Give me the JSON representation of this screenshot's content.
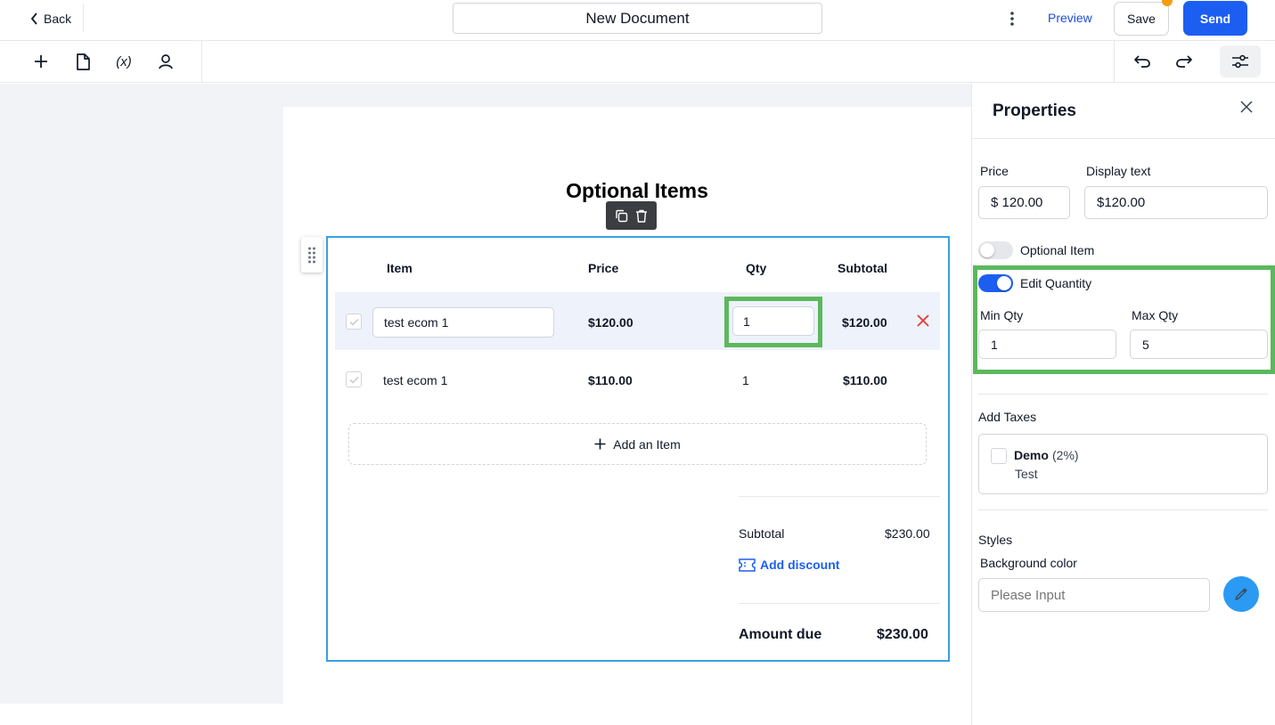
{
  "header": {
    "back_label": "Back",
    "doc_title": "New Document",
    "preview_label": "Preview",
    "save_label": "Save",
    "send_label": "Send"
  },
  "toolbar": {
    "items": [
      "add-icon",
      "document-icon",
      "variable-icon",
      "person-icon"
    ],
    "variable_label": "(x)",
    "right_items": [
      "undo-icon",
      "redo-icon",
      "settings-sliders-icon"
    ]
  },
  "block": {
    "title": "Optional Items",
    "columns": [
      "Item",
      "Price",
      "Qty",
      "Subtotal"
    ],
    "rows": [
      {
        "item": "test ecom 1",
        "price": "$120.00",
        "qty": "1",
        "subtotal": "$120.00",
        "checked": true,
        "editing": true
      },
      {
        "item": "test ecom 1",
        "price": "$110.00",
        "qty": "1",
        "subtotal": "$110.00",
        "checked": true,
        "editing": false
      }
    ],
    "add_item_label": "Add an Item",
    "subtotal_label": "Subtotal",
    "subtotal_value": "$230.00",
    "add_discount_label": "Add discount",
    "amount_due_label": "Amount due",
    "amount_due_value": "$230.00"
  },
  "properties": {
    "title": "Properties",
    "price_label": "Price",
    "price_value": "$ 120.00",
    "display_text_label": "Display text",
    "display_text_value": "$120.00",
    "optional_item_label": "Optional Item",
    "optional_item_on": false,
    "edit_quantity_label": "Edit Quantity",
    "edit_quantity_on": true,
    "min_qty_label": "Min Qty",
    "min_qty_value": "1",
    "max_qty_label": "Max Qty",
    "max_qty_value": "5",
    "add_taxes_label": "Add Taxes",
    "tax_name": "Demo",
    "tax_rate": "(2%)",
    "tax_desc": "Test",
    "styles_label": "Styles",
    "bg_color_label": "Background color",
    "bg_color_placeholder": "Please Input"
  },
  "colors": {
    "accent": "#1d5ef2",
    "highlight": "#5cb85c",
    "block_border": "#3b9fe3",
    "notification_dot": "#f59e0b",
    "delete": "#e53935"
  }
}
